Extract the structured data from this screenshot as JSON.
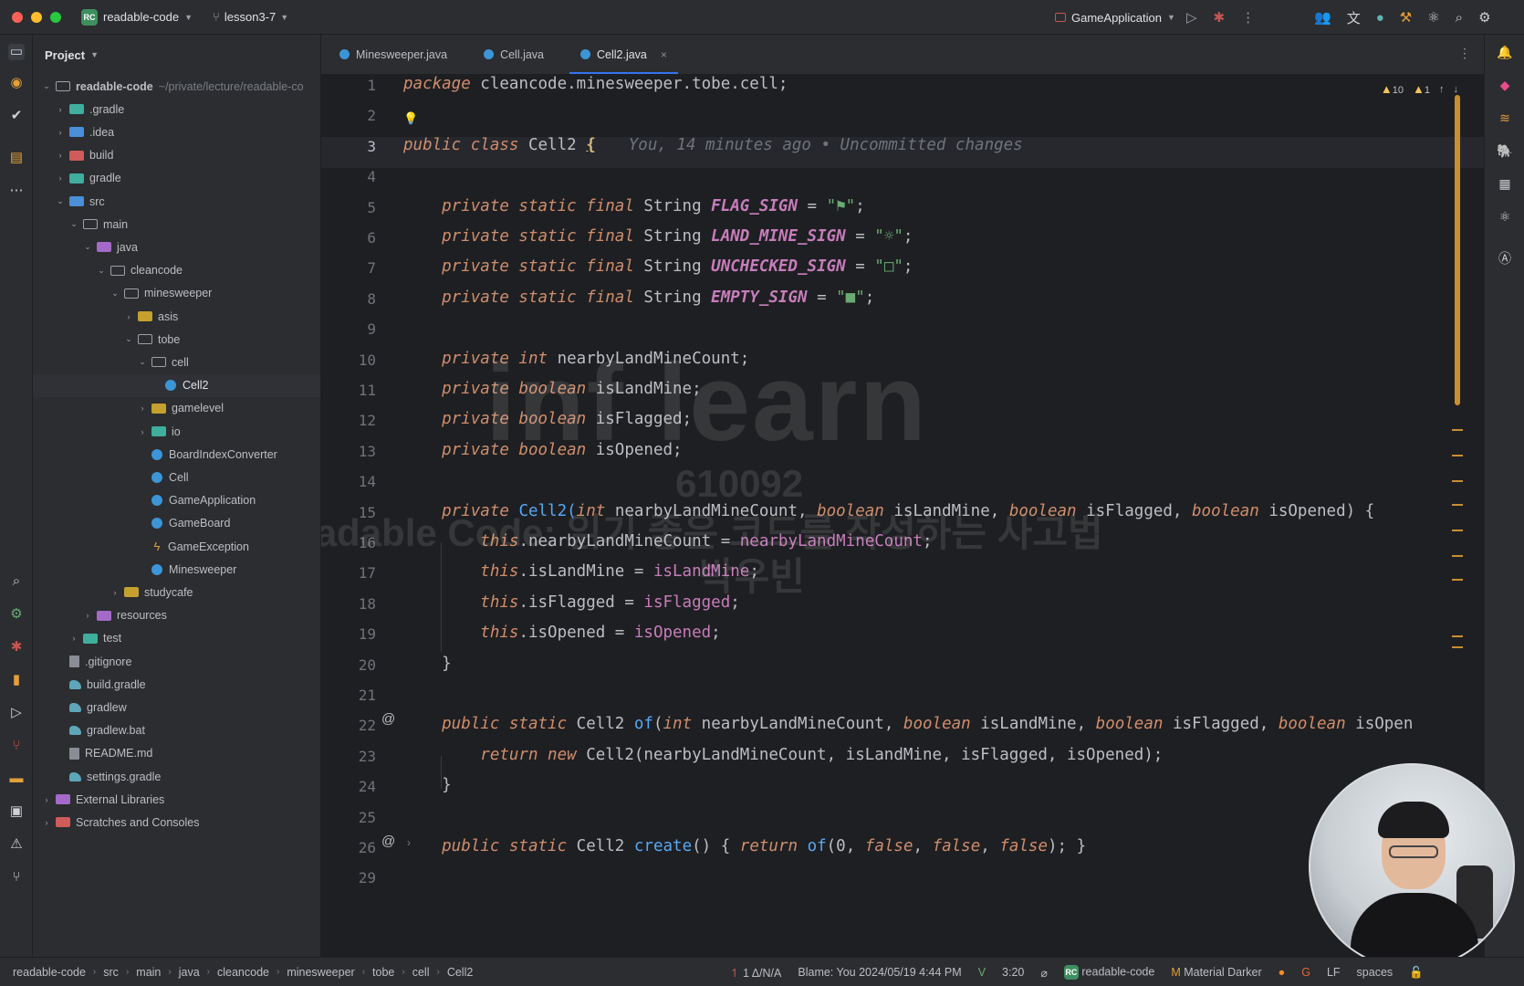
{
  "window": {
    "project_name": "readable-code",
    "project_badge": "RC",
    "branch": "lesson3-7",
    "run_config": "GameApplication"
  },
  "project_panel": {
    "title": "Project",
    "tree": [
      {
        "label": "readable-code",
        "hint": "~/private/lecture/readable-co",
        "depth": 0,
        "open": true,
        "icon": "folder-o"
      },
      {
        "label": ".gradle",
        "depth": 1,
        "open": false,
        "icon": "folder-teal"
      },
      {
        "label": ".idea",
        "depth": 1,
        "open": false,
        "icon": "folder-blue"
      },
      {
        "label": "build",
        "depth": 1,
        "open": false,
        "icon": "folder-red"
      },
      {
        "label": "gradle",
        "depth": 1,
        "open": false,
        "icon": "folder-teal"
      },
      {
        "label": "src",
        "depth": 1,
        "open": true,
        "icon": "folder-blue"
      },
      {
        "label": "main",
        "depth": 2,
        "open": true,
        "icon": "folder-o"
      },
      {
        "label": "java",
        "depth": 3,
        "open": true,
        "icon": "folder-purple"
      },
      {
        "label": "cleancode",
        "depth": 4,
        "open": true,
        "icon": "folder-o"
      },
      {
        "label": "minesweeper",
        "depth": 5,
        "open": true,
        "icon": "folder-o"
      },
      {
        "label": "asis",
        "depth": 6,
        "open": false,
        "icon": "folder"
      },
      {
        "label": "tobe",
        "depth": 6,
        "open": true,
        "icon": "folder-o"
      },
      {
        "label": "cell",
        "depth": 7,
        "open": true,
        "icon": "folder-o"
      },
      {
        "label": "Cell2",
        "depth": 8,
        "leaf": true,
        "icon": "java",
        "selected": true
      },
      {
        "label": "gamelevel",
        "depth": 7,
        "open": false,
        "icon": "folder"
      },
      {
        "label": "io",
        "depth": 7,
        "open": false,
        "icon": "folder-teal"
      },
      {
        "label": "BoardIndexConverter",
        "depth": 7,
        "leaf": true,
        "icon": "java"
      },
      {
        "label": "Cell",
        "depth": 7,
        "leaf": true,
        "icon": "java"
      },
      {
        "label": "GameApplication",
        "depth": 7,
        "leaf": true,
        "icon": "java"
      },
      {
        "label": "GameBoard",
        "depth": 7,
        "leaf": true,
        "icon": "java"
      },
      {
        "label": "GameException",
        "depth": 7,
        "leaf": true,
        "icon": "exc"
      },
      {
        "label": "Minesweeper",
        "depth": 7,
        "leaf": true,
        "icon": "java"
      },
      {
        "label": "studycafe",
        "depth": 5,
        "open": false,
        "icon": "folder"
      },
      {
        "label": "resources",
        "depth": 3,
        "open": false,
        "icon": "folder-purple"
      },
      {
        "label": "test",
        "depth": 2,
        "open": false,
        "icon": "folder-teal"
      },
      {
        "label": ".gitignore",
        "depth": 1,
        "leaf": true,
        "icon": "file"
      },
      {
        "label": "build.gradle",
        "depth": 1,
        "leaf": true,
        "icon": "gradle"
      },
      {
        "label": "gradlew",
        "depth": 1,
        "leaf": true,
        "icon": "gradle"
      },
      {
        "label": "gradlew.bat",
        "depth": 1,
        "leaf": true,
        "icon": "gradle"
      },
      {
        "label": "README.md",
        "depth": 1,
        "leaf": true,
        "icon": "file"
      },
      {
        "label": "settings.gradle",
        "depth": 1,
        "leaf": true,
        "icon": "gradle"
      },
      {
        "label": "External Libraries",
        "depth": 0,
        "open": false,
        "icon": "folder-purple"
      },
      {
        "label": "Scratches and Consoles",
        "depth": 0,
        "open": false,
        "icon": "folder-red"
      }
    ]
  },
  "tabs": [
    {
      "label": "Minesweeper.java",
      "active": false
    },
    {
      "label": "Cell.java",
      "active": false
    },
    {
      "label": "Cell2.java",
      "active": true
    }
  ],
  "inspections": {
    "warnings": "10",
    "weak_warnings": "1"
  },
  "editor": {
    "line_numbers": [
      "1",
      "2",
      "3",
      "4",
      "5",
      "6",
      "7",
      "8",
      "9",
      "10",
      "11",
      "12",
      "13",
      "14",
      "15",
      "16",
      "17",
      "18",
      "19",
      "20",
      "21",
      "22",
      "23",
      "24",
      "25",
      "26",
      "29"
    ],
    "blame_hint": "You, 14 minutes ago • Uncommitted changes",
    "lines": [
      [
        {
          "t": "package",
          "c": "kw"
        },
        {
          "t": " cleancode.minesweeper.tobe.cell;",
          "c": "ty"
        }
      ],
      [],
      [
        {
          "t": "public class",
          "c": "kw"
        },
        {
          "t": " Cell2 ",
          "c": "cls"
        },
        {
          "t": "{",
          "c": "brace-hl"
        }
      ],
      [],
      [
        {
          "t": "    private static final",
          "c": "kw"
        },
        {
          "t": " String ",
          "c": "ty"
        },
        {
          "t": "FLAG_SIGN",
          "c": "cst"
        },
        {
          "t": " = ",
          "c": "ty"
        },
        {
          "t": "\"⚑\"",
          "c": "str"
        },
        {
          "t": ";",
          "c": "ty"
        }
      ],
      [
        {
          "t": "    private static final",
          "c": "kw"
        },
        {
          "t": " String ",
          "c": "ty"
        },
        {
          "t": "LAND_MINE_SIGN",
          "c": "cst"
        },
        {
          "t": " = ",
          "c": "ty"
        },
        {
          "t": "\"☼\"",
          "c": "str"
        },
        {
          "t": ";",
          "c": "ty"
        }
      ],
      [
        {
          "t": "    private static final",
          "c": "kw"
        },
        {
          "t": " String ",
          "c": "ty"
        },
        {
          "t": "UNCHECKED_SIGN",
          "c": "cst"
        },
        {
          "t": " = ",
          "c": "ty"
        },
        {
          "t": "\"□\"",
          "c": "str"
        },
        {
          "t": ";",
          "c": "ty"
        }
      ],
      [
        {
          "t": "    private static final",
          "c": "kw"
        },
        {
          "t": " String ",
          "c": "ty"
        },
        {
          "t": "EMPTY_SIGN",
          "c": "cst"
        },
        {
          "t": " = ",
          "c": "ty"
        },
        {
          "t": "\"■\"",
          "c": "str"
        },
        {
          "t": ";",
          "c": "ty"
        }
      ],
      [],
      [
        {
          "t": "    private int",
          "c": "kw"
        },
        {
          "t": " nearbyLandMineCount;",
          "c": "ty"
        }
      ],
      [
        {
          "t": "    private boolean",
          "c": "kw"
        },
        {
          "t": " isLandMine;",
          "c": "ty"
        }
      ],
      [
        {
          "t": "    private boolean",
          "c": "kw"
        },
        {
          "t": " isFlagged;",
          "c": "ty"
        }
      ],
      [
        {
          "t": "    private boolean",
          "c": "kw"
        },
        {
          "t": " isOpened;",
          "c": "ty"
        }
      ],
      [],
      [
        {
          "t": "    private",
          "c": "kw"
        },
        {
          "t": " Cell2(",
          "c": "mth"
        },
        {
          "t": "int",
          "c": "kw"
        },
        {
          "t": " nearbyLandMineCount, ",
          "c": "prm"
        },
        {
          "t": "boolean",
          "c": "kw"
        },
        {
          "t": " isLandMine, ",
          "c": "prm"
        },
        {
          "t": "boolean",
          "c": "kw"
        },
        {
          "t": " isFlagged, ",
          "c": "prm"
        },
        {
          "t": "boolean",
          "c": "kw"
        },
        {
          "t": " isOpened) {",
          "c": "prm"
        }
      ],
      [
        {
          "t": "        this",
          "c": "kw"
        },
        {
          "t": ".nearbyLandMineCount = ",
          "c": "ty"
        },
        {
          "t": "nearbyLandMineCount",
          "c": "fld"
        },
        {
          "t": ";",
          "c": "ty"
        }
      ],
      [
        {
          "t": "        this",
          "c": "kw"
        },
        {
          "t": ".isLandMine = ",
          "c": "ty"
        },
        {
          "t": "isLandMine",
          "c": "fld"
        },
        {
          "t": ";",
          "c": "ty"
        }
      ],
      [
        {
          "t": "        this",
          "c": "kw"
        },
        {
          "t": ".isFlagged = ",
          "c": "ty"
        },
        {
          "t": "isFlagged",
          "c": "fld"
        },
        {
          "t": ";",
          "c": "ty"
        }
      ],
      [
        {
          "t": "        this",
          "c": "kw"
        },
        {
          "t": ".isOpened = ",
          "c": "ty"
        },
        {
          "t": "isOpened",
          "c": "fld"
        },
        {
          "t": ";",
          "c": "ty"
        }
      ],
      [
        {
          "t": "    }",
          "c": "ty"
        }
      ],
      [],
      [
        {
          "t": "    public static",
          "c": "kw"
        },
        {
          "t": " Cell2 ",
          "c": "ty"
        },
        {
          "t": "of",
          "c": "mth"
        },
        {
          "t": "(",
          "c": "ty"
        },
        {
          "t": "int",
          "c": "kw"
        },
        {
          "t": " nearbyLandMineCount, ",
          "c": "prm"
        },
        {
          "t": "boolean",
          "c": "kw"
        },
        {
          "t": " isLandMine, ",
          "c": "prm"
        },
        {
          "t": "boolean",
          "c": "kw"
        },
        {
          "t": " isFlagged, ",
          "c": "prm"
        },
        {
          "t": "boolean",
          "c": "kw"
        },
        {
          "t": " isOpen",
          "c": "prm"
        }
      ],
      [
        {
          "t": "        return new",
          "c": "kw"
        },
        {
          "t": " Cell2(nearbyLandMineCount, isLandMine, isFlagged, isOpened);",
          "c": "ty"
        }
      ],
      [
        {
          "t": "    }",
          "c": "ty"
        }
      ],
      [],
      [
        {
          "t": "    public static",
          "c": "kw"
        },
        {
          "t": " Cell2 ",
          "c": "ty"
        },
        {
          "t": "create",
          "c": "mth"
        },
        {
          "t": "() { ",
          "c": "ty"
        },
        {
          "t": "return",
          "c": "kw"
        },
        {
          "t": " ",
          "c": "ty"
        },
        {
          "t": "of",
          "c": "mth"
        },
        {
          "t": "(0, ",
          "c": "ty"
        },
        {
          "t": "false",
          "c": "kw"
        },
        {
          "t": ", ",
          "c": "ty"
        },
        {
          "t": "false",
          "c": "kw"
        },
        {
          "t": ", ",
          "c": "ty"
        },
        {
          "t": "false",
          "c": "kw"
        },
        {
          "t": "); }",
          "c": "ty"
        }
      ],
      []
    ]
  },
  "watermark": {
    "logo": "inf learn",
    "code": "610092",
    "course": "Readable Code: 읽기 좋은 코드를 작성하는 사고법",
    "author": "박우빈"
  },
  "statusbar": {
    "breadcrumbs": [
      "readable-code",
      "src",
      "main",
      "java",
      "cleancode",
      "minesweeper",
      "tobe",
      "cell",
      "Cell2"
    ],
    "vcs": "1 Δ/N/A",
    "blame": "Blame: You 2024/05/19 4:44 PM",
    "position": "3:20",
    "project": "readable-code",
    "theme": "Material Darker",
    "line_sep": "LF",
    "indent": "spaces"
  },
  "colors": {
    "keyword": "#cf8e6d",
    "constant": "#c77dbb",
    "string": "#6aab73",
    "method": "#56a8f5",
    "accent": "#3574f0",
    "warning": "#f2c55c"
  }
}
